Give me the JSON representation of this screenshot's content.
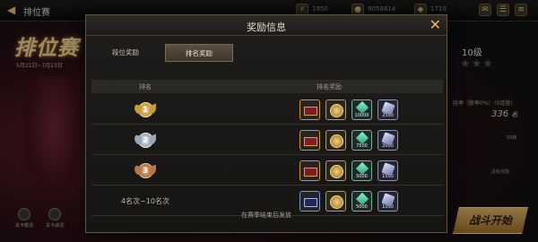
{
  "screen": {
    "back_icon": "back-arrow-icon",
    "title": "排位赛",
    "resource_1": "1950",
    "resource_2": "9058814",
    "resource_3": "1710",
    "season_banner": "排位赛",
    "season_date": "5月21日~7月23日",
    "bottom_left_1": "关卡概况",
    "bottom_left_2": "关卡战况",
    "level": "10级",
    "stars": "★★★",
    "rate_text": "胜率（胜率0%）（0连胜）",
    "score": "336",
    "score_unit": "名",
    "lvl50": "50级",
    "no_reward": "没有奖励",
    "start_button": "战斗开始"
  },
  "modal": {
    "title": "奖励信息",
    "close_icon": "close-x-icon",
    "tabs": [
      {
        "label": "段位奖励",
        "active": false
      },
      {
        "label": "排名奖励",
        "active": true
      }
    ],
    "columns": {
      "rank": "排名",
      "reward": "排名奖励"
    },
    "rows": [
      {
        "rank_medal": "1",
        "medal_style": "gold",
        "items": [
          {
            "kind": "box-red",
            "qty": ""
          },
          {
            "kind": "coin",
            "qty": ""
          },
          {
            "kind": "gem",
            "qty": "10000"
          },
          {
            "kind": "crystal",
            "qty": "2500"
          }
        ]
      },
      {
        "rank_medal": "2",
        "medal_style": "silver",
        "items": [
          {
            "kind": "box-red",
            "qty": ""
          },
          {
            "kind": "coin",
            "qty": ""
          },
          {
            "kind": "gem",
            "qty": "7500"
          },
          {
            "kind": "crystal",
            "qty": "2000"
          }
        ]
      },
      {
        "rank_medal": "3",
        "medal_style": "bronze",
        "items": [
          {
            "kind": "box-red",
            "qty": ""
          },
          {
            "kind": "coin",
            "qty": ""
          },
          {
            "kind": "gem",
            "qty": "5000"
          },
          {
            "kind": "crystal",
            "qty": "1500"
          }
        ]
      },
      {
        "rank_text": "4名次~10名次",
        "items": [
          {
            "kind": "box-blue",
            "qty": ""
          },
          {
            "kind": "coin",
            "qty": ""
          },
          {
            "kind": "gem",
            "qty": "5000"
          },
          {
            "kind": "crystal",
            "qty": "1000"
          }
        ]
      }
    ],
    "footer_note": "在赛季结束后发放"
  }
}
